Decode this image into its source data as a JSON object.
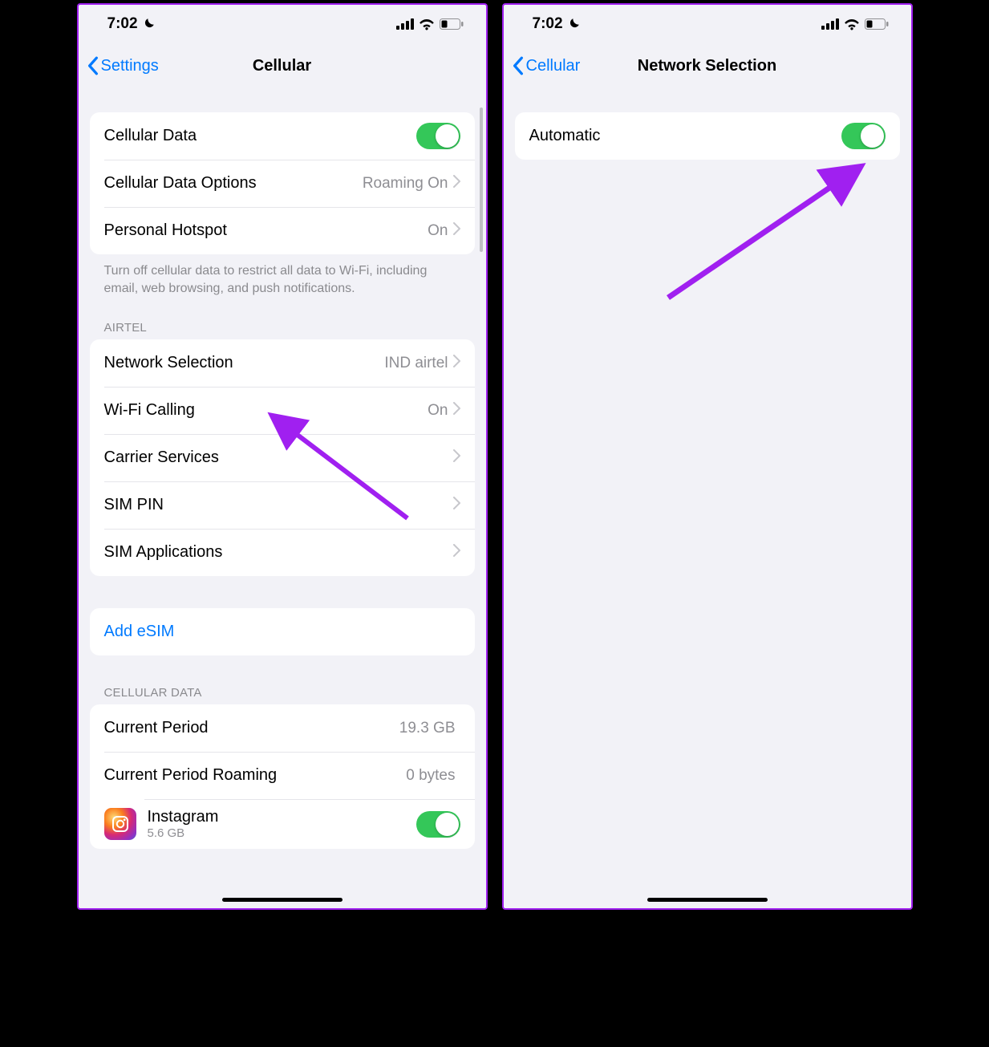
{
  "left": {
    "status_time": "7:02",
    "nav": {
      "back": "Settings",
      "title": "Cellular"
    },
    "group1": {
      "cellular_data": "Cellular Data",
      "cellular_options": "Cellular Data Options",
      "cellular_options_value": "Roaming On",
      "hotspot": "Personal Hotspot",
      "hotspot_value": "On"
    },
    "group1_footer": "Turn off cellular data to restrict all data to Wi-Fi, including email, web browsing, and push notifications.",
    "section_carrier": "AIRTEL",
    "group2": {
      "network_selection": "Network Selection",
      "network_selection_value": "IND airtel",
      "wifi_calling": "Wi-Fi Calling",
      "wifi_calling_value": "On",
      "carrier_services": "Carrier Services",
      "sim_pin": "SIM PIN",
      "sim_apps": "SIM Applications"
    },
    "add_esim": "Add eSIM",
    "section_data": "CELLULAR DATA",
    "group4": {
      "current_period": "Current Period",
      "current_period_value": "19.3 GB",
      "roaming": "Current Period Roaming",
      "roaming_value": "0 bytes",
      "app1_name": "Instagram",
      "app1_size": "5.6 GB"
    }
  },
  "right": {
    "status_time": "7:02",
    "nav": {
      "back": "Cellular",
      "title": "Network Selection"
    },
    "automatic": "Automatic"
  }
}
